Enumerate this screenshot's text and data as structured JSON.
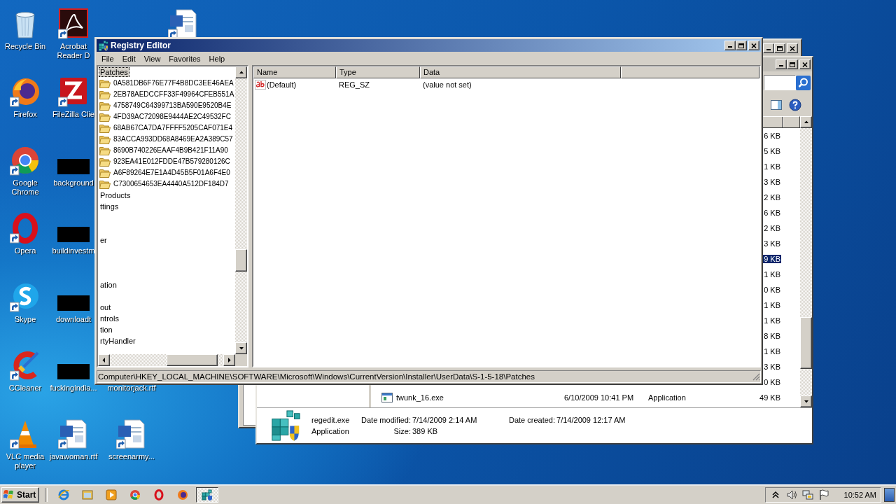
{
  "desktop_icons": [
    {
      "kind": "recycle",
      "label": "Recycle Bin"
    },
    {
      "kind": "firefox",
      "label": "Firefox"
    },
    {
      "kind": "chrome",
      "label": "Google Chrome"
    },
    {
      "kind": "opera",
      "label": "Opera"
    },
    {
      "kind": "skype",
      "label": "Skype"
    },
    {
      "kind": "ccleaner",
      "label": "CCleaner"
    },
    {
      "kind": "vlc",
      "label": "VLC media player"
    },
    {
      "kind": "acrobat",
      "label": "Acrobat Reader D"
    },
    {
      "kind": "filezilla",
      "label": "FileZilla Clie"
    },
    {
      "kind": "redacted",
      "label": "background"
    },
    {
      "kind": "redacted",
      "label": "buildinvestm"
    },
    {
      "kind": "redacted",
      "label": "downloadt"
    },
    {
      "kind": "redacted",
      "label": "fuckingindia..."
    },
    {
      "kind": "word",
      "label": "javawoman.rtf"
    },
    {
      "kind": "word"
    },
    {
      "kind": "covered",
      "label": "monitorjack.rtf"
    },
    {
      "kind": "word",
      "label": "screenarmy..."
    }
  ],
  "explorer": {
    "rows": [
      {
        "size": "6 KB",
        "selected": false
      },
      {
        "size": "5 KB",
        "selected": false
      },
      {
        "size": "1 KB",
        "selected": false
      },
      {
        "size": "3 KB",
        "selected": false
      },
      {
        "size": "2 KB",
        "selected": false
      },
      {
        "size": "6 KB",
        "selected": false
      },
      {
        "size": "2 KB",
        "selected": false
      },
      {
        "size": "3 KB",
        "selected": false
      },
      {
        "size": "9 KB",
        "selected": true
      },
      {
        "size": "1 KB",
        "selected": false
      },
      {
        "size": "0 KB",
        "selected": false
      },
      {
        "size": "1 KB",
        "selected": false
      },
      {
        "size": "1 KB",
        "selected": false
      },
      {
        "size": "8 KB",
        "selected": false
      },
      {
        "size": "1 KB",
        "selected": false
      },
      {
        "size": "3 KB",
        "selected": false
      },
      {
        "size": "0 KB",
        "selected": false
      },
      {
        "name": "twunk_16.exe",
        "date": "6/10/2009 10:41 PM",
        "type": "Application",
        "size": "49 KB",
        "selected": false
      }
    ],
    "details": {
      "file_name": "regedit.exe",
      "file_type": "Application",
      "fields": [
        {
          "label": "Date modified:",
          "value": "7/14/2009 2:14 AM"
        },
        {
          "label": "Date created:",
          "value": "7/14/2009 12:17 AM"
        },
        {
          "label": "Size:",
          "value": "389 KB"
        }
      ]
    }
  },
  "registry_editor": {
    "title": "Registry Editor",
    "menu": [
      "File",
      "Edit",
      "View",
      "Favorites",
      "Help"
    ],
    "tree": [
      {
        "label": "Patches",
        "selected": true,
        "children": [
          {
            "label": "0A581DB6F76E77F4B8DC3EE46AEA",
            "selected": false
          },
          {
            "label": "2EB78AEDCCFF33F49964CFEB551A",
            "selected": false
          },
          {
            "label": "4758749C64399713BA590E9520B4E",
            "selected": false
          },
          {
            "label": "4FD39AC72098E9444AE2C49532FC",
            "selected": false
          },
          {
            "label": "68AB67CA7DA7FFFF5205CAF071E4",
            "selected": false
          },
          {
            "label": "83ACCA993DD68A8469EA2A389C57",
            "selected": false
          },
          {
            "label": "8690B740226EAAF4B9B421F11A90",
            "selected": false
          },
          {
            "label": "923EA41E012FDDE47B579280126C",
            "selected": false
          },
          {
            "label": "A6F89264E7E1A4D45B5F01A6F4E0",
            "selected": false
          },
          {
            "label": "C7300654653EA4440A512DF184D7",
            "selected": false
          }
        ]
      },
      {
        "label": "Products",
        "selected": false
      },
      {
        "label": "ttings",
        "selected": false
      },
      {
        "label": "er",
        "selected": false
      },
      {
        "label": "ation",
        "selected": false
      },
      {
        "label": "out",
        "selected": false
      },
      {
        "label": "ntrols",
        "selected": false
      },
      {
        "label": "tion",
        "selected": false
      },
      {
        "label": "rtyHandler",
        "selected": false
      }
    ],
    "columns": [
      "Name",
      "Type",
      "Data"
    ],
    "values": [
      {
        "name": "(Default)",
        "type": "REG_SZ",
        "data": "(value not set)"
      }
    ],
    "status_bar": "Computer\\HKEY_LOCAL_MACHINE\\SOFTWARE\\Microsoft\\Windows\\CurrentVersion\\Installer\\UserData\\S-1-5-18\\Patches"
  },
  "taskbar": {
    "start": "Start",
    "quick_launch": [
      {
        "kind": "ie"
      },
      {
        "kind": "folder"
      },
      {
        "kind": "media"
      },
      {
        "kind": "chrome"
      },
      {
        "kind": "opera"
      },
      {
        "kind": "firefox"
      }
    ],
    "tasks": [
      {
        "kind": "regedit",
        "selected": true
      }
    ],
    "tray": [
      {
        "kind": "chevron"
      },
      {
        "kind": "speaker"
      },
      {
        "kind": "network"
      },
      {
        "kind": "flag"
      }
    ],
    "clock": "10:52 AM"
  }
}
